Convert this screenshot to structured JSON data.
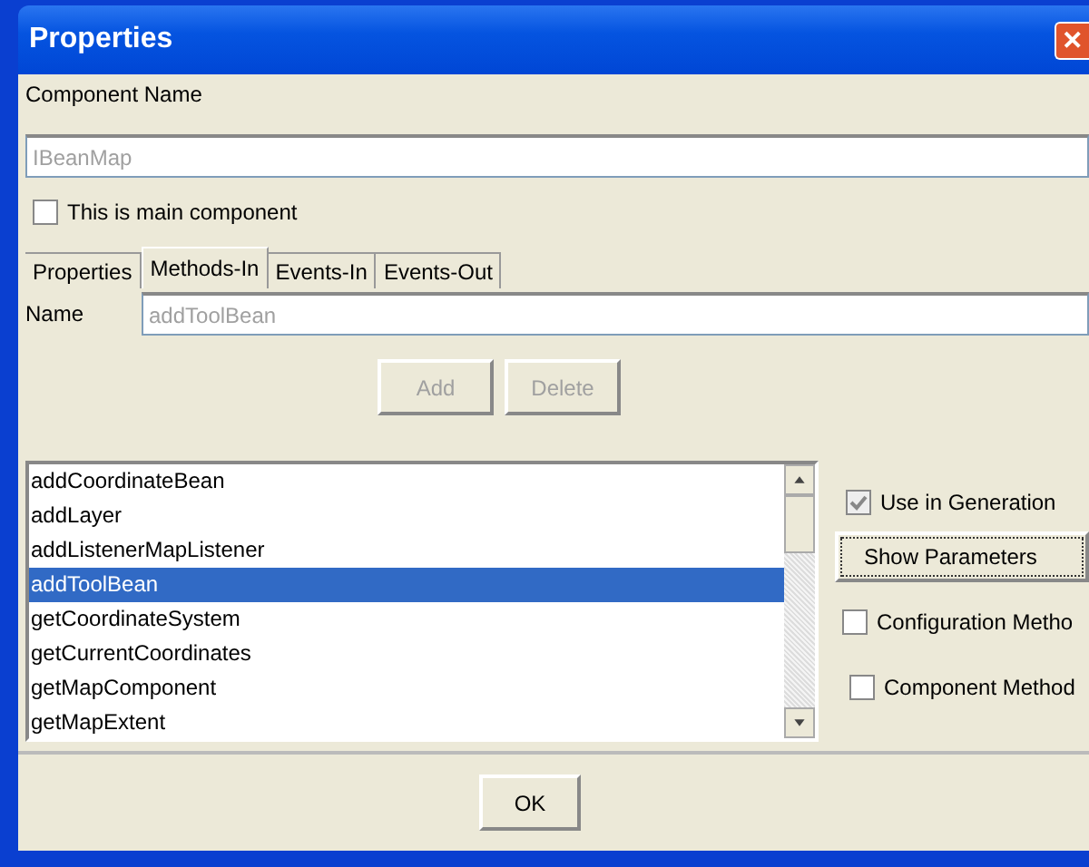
{
  "window": {
    "title": "Properties",
    "close": "✕"
  },
  "component_name": {
    "label": "Component Name",
    "value": "IBeanMap",
    "disabled": true
  },
  "main_component": {
    "label": "This is main component",
    "checked": false
  },
  "tabs": [
    {
      "label": "Properties",
      "selected": false
    },
    {
      "label": "Methods-In",
      "selected": true
    },
    {
      "label": "Events-In",
      "selected": false
    },
    {
      "label": "Events-Out",
      "selected": false
    }
  ],
  "name_field": {
    "label": "Name",
    "value": "addToolBean",
    "disabled": true
  },
  "actions": [
    {
      "label": "Add",
      "disabled": true
    },
    {
      "label": "Delete",
      "disabled": true
    }
  ],
  "methods": [
    {
      "label": "addCoordinateBean",
      "selected": false
    },
    {
      "label": "addLayer",
      "selected": false
    },
    {
      "label": "addListenerMapListener",
      "selected": false
    },
    {
      "label": "addToolBean",
      "selected": true
    },
    {
      "label": "getCoordinateSystem",
      "selected": false
    },
    {
      "label": "getCurrentCoordinates",
      "selected": false
    },
    {
      "label": "getMapComponent",
      "selected": false
    },
    {
      "label": "getMapExtent",
      "selected": false
    }
  ],
  "options": [
    {
      "kind": "checkbox",
      "label": "Use in Generation",
      "checked": true,
      "disabled": true
    },
    {
      "kind": "button",
      "label": "Show Parameters"
    },
    {
      "kind": "checkbox",
      "label": "Configuration Metho",
      "checked": false,
      "disabled": false
    },
    {
      "kind": "checkbox",
      "label": "Component Method",
      "checked": false,
      "disabled": false
    }
  ],
  "buttons": [
    {
      "label": "OK"
    }
  ]
}
